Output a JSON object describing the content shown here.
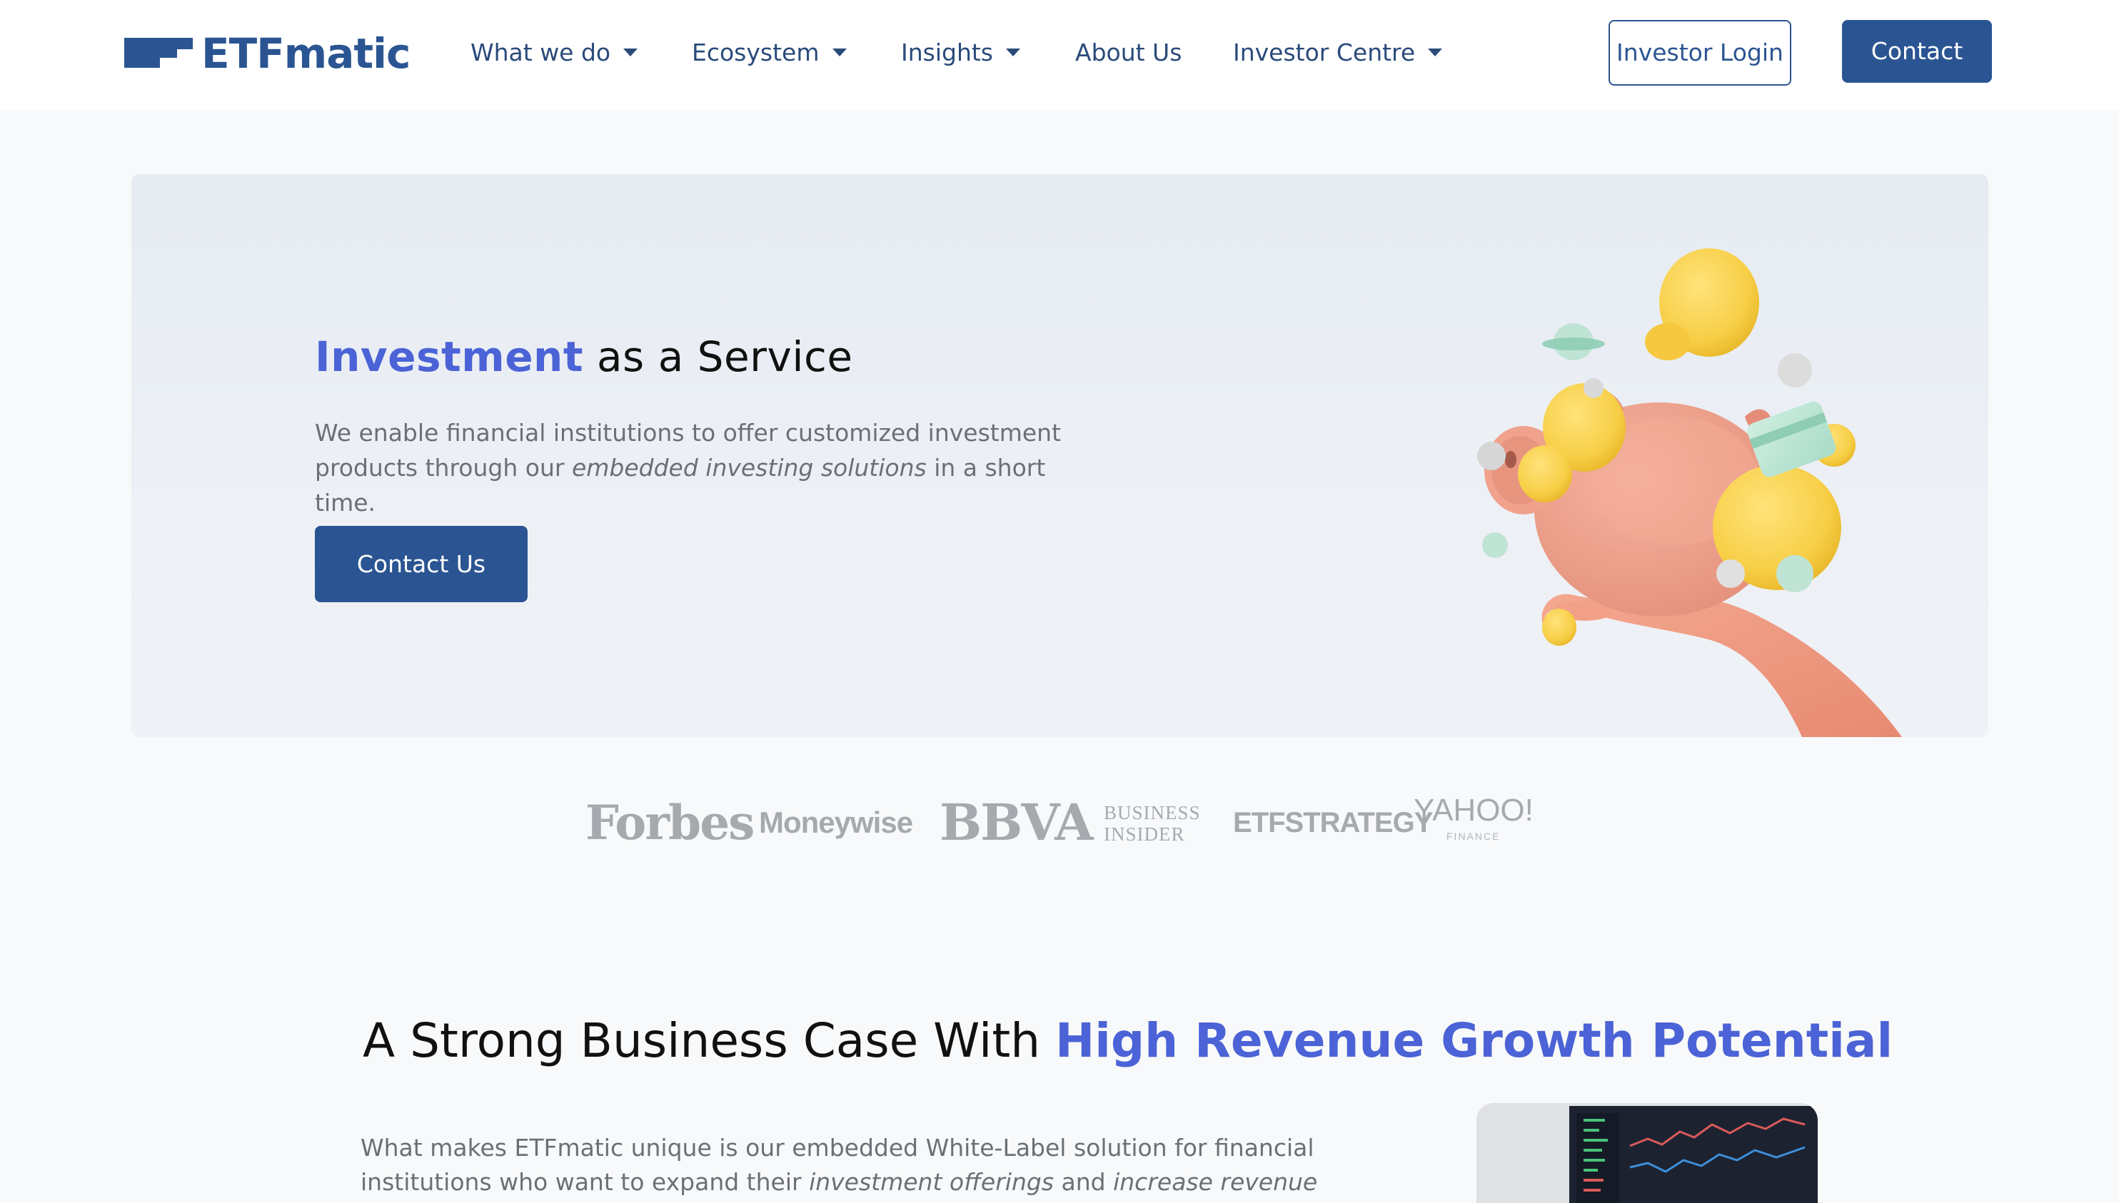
{
  "header": {
    "logo_text": "ETFmatic",
    "brand_color": "#2b5592",
    "nav": [
      {
        "label": "What we do",
        "has_dropdown": true
      },
      {
        "label": "Ecosystem",
        "has_dropdown": true
      },
      {
        "label": "Insights",
        "has_dropdown": true
      },
      {
        "label": "About Us",
        "has_dropdown": false
      },
      {
        "label": "Investor Centre",
        "has_dropdown": true
      }
    ],
    "login_label": "Investor Login",
    "contact_label": "Contact"
  },
  "hero": {
    "title_accent": "Investment",
    "title_rest": " as a Service",
    "desc_part1": "We enable financial institutions to offer customized investment products through our ",
    "desc_emphasis": "embedded investing solutions",
    "desc_part2": " in a short time.",
    "cta_label": "Contact Us",
    "accent_color": "#4b63d6"
  },
  "press": {
    "forbes": "Forbes",
    "moneywise": "Moneywise",
    "bbva": "BBVA",
    "business_insider_line1": "BUSINESS",
    "business_insider_line2": "INSIDER",
    "etf_strategy": "ETFSTRATEGY",
    "yahoo": "YAHOO!",
    "yahoo_sub": "FINANCE"
  },
  "business_case": {
    "title_plain": "A Strong Business Case With ",
    "title_accent": "High Revenue Growth Potential",
    "desc_part1": "What makes ETFmatic unique is our embedded White-Label solution for financial institutions who want to expand their ",
    "desc_em1": "investment offerings",
    "desc_part2": " and ",
    "desc_em2": "increase revenue"
  }
}
